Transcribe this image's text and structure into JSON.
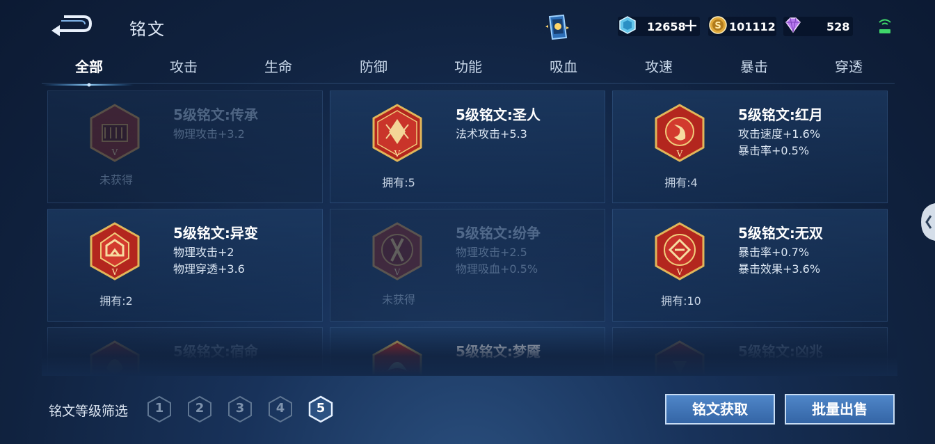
{
  "header": {
    "title": "铭文",
    "back_icon": "back-arrow-icon",
    "currencies": [
      {
        "name": "diamond",
        "value": "12658",
        "icon": "diamond-icon",
        "color": "#63c5ea"
      },
      {
        "name": "gold",
        "value": "101112",
        "icon": "gold-coin-icon",
        "color": "#e0a93a"
      },
      {
        "name": "gem",
        "value": "528",
        "icon": "purple-gem-icon",
        "color": "#b779ef"
      }
    ],
    "plus_label": "+"
  },
  "tabs": [
    {
      "label": "全部",
      "active": true
    },
    {
      "label": "攻击"
    },
    {
      "label": "生命"
    },
    {
      "label": "防御"
    },
    {
      "label": "功能"
    },
    {
      "label": "吸血"
    },
    {
      "label": "攻速"
    },
    {
      "label": "暴击"
    },
    {
      "label": "穿透"
    }
  ],
  "inscriptions": [
    {
      "name": "5级铭文:传承",
      "attrs": [
        "物理攻击+3.2"
      ],
      "owned": "未获得",
      "acquired": false
    },
    {
      "name": "5级铭文:圣人",
      "attrs": [
        "法术攻击+5.3"
      ],
      "owned": "拥有:5",
      "acquired": true
    },
    {
      "name": "5级铭文:红月",
      "attrs": [
        "攻击速度+1.6%",
        "暴击率+0.5%"
      ],
      "owned": "拥有:4",
      "acquired": true
    },
    {
      "name": "5级铭文:异变",
      "attrs": [
        "物理攻击+2",
        "物理穿透+3.6"
      ],
      "owned": "拥有:2",
      "acquired": true
    },
    {
      "name": "5级铭文:纷争",
      "attrs": [
        "物理攻击+2.5",
        "物理吸血+0.5%"
      ],
      "owned": "未获得",
      "acquired": false
    },
    {
      "name": "5级铭文:无双",
      "attrs": [
        "暴击率+0.7%",
        "暴击效果+3.6%"
      ],
      "owned": "拥有:10",
      "acquired": true
    },
    {
      "name": "5级铭文:宿命",
      "attrs": [],
      "owned": "",
      "acquired": false
    },
    {
      "name": "5级铭文:梦魇",
      "attrs": [],
      "owned": "",
      "acquired": true
    },
    {
      "name": "5级铭文:凶兆",
      "attrs": [],
      "owned": "",
      "acquired": false
    }
  ],
  "footer": {
    "filter_label": "铭文等级筛选",
    "levels": [
      "1",
      "2",
      "3",
      "4",
      "5"
    ],
    "active_level": "5",
    "get_button": "铭文获取",
    "sell_button": "批量出售"
  },
  "colors": {
    "accent": "#4f86c8",
    "emblem_red": "#b3261e",
    "emblem_gold": "#e1b65a"
  }
}
